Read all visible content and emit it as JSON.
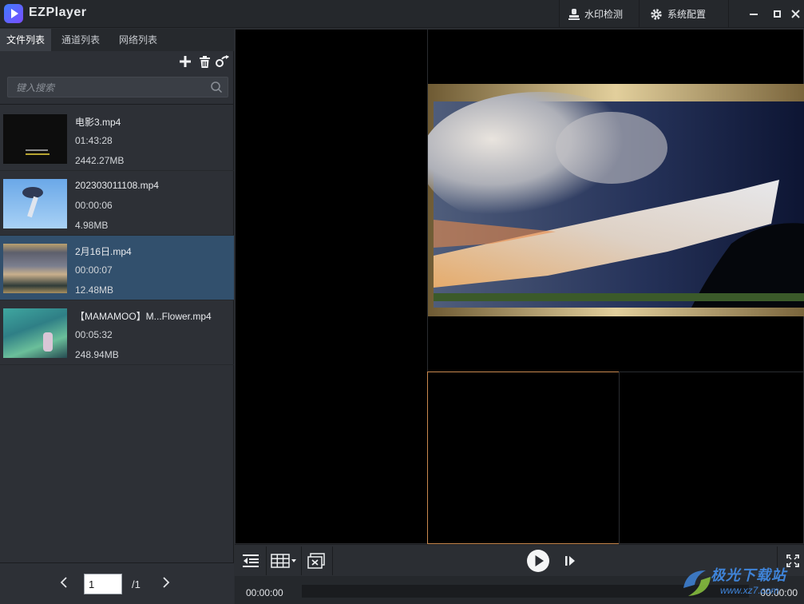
{
  "app": {
    "title": "EZPlayer"
  },
  "titlebar": {
    "watermark_check": "水印检测",
    "system_config": "系统配置"
  },
  "tabs": [
    {
      "label": "文件列表",
      "active": true
    },
    {
      "label": "通道列表",
      "active": false
    },
    {
      "label": "网络列表",
      "active": false
    }
  ],
  "toolbar_icons": [
    "add-icon",
    "trash-icon",
    "share-icon"
  ],
  "search": {
    "placeholder": "键入搜索",
    "value": ""
  },
  "files": [
    {
      "name": "电影3.mp4",
      "duration": "01:43:28",
      "size": "2442.27MB",
      "selected": false
    },
    {
      "name": "202303011108.mp4",
      "duration": "00:00:06",
      "size": "4.98MB",
      "selected": false
    },
    {
      "name": "2月16日.mp4",
      "duration": "00:00:07",
      "size": "12.48MB",
      "selected": true
    },
    {
      "name": "【MAMAMOO】M...Flower.mp4",
      "duration": "00:05:32",
      "size": "248.94MB",
      "selected": false
    }
  ],
  "pager": {
    "current": "1",
    "total": "/1"
  },
  "playback": {
    "time_current": "00:00:00",
    "time_total": "00:00:00"
  },
  "watermark": {
    "title": "极光下载站",
    "url": "www.xz7.com"
  },
  "colors": {
    "accent": "#c9894f",
    "selected_row": "#32506d"
  }
}
